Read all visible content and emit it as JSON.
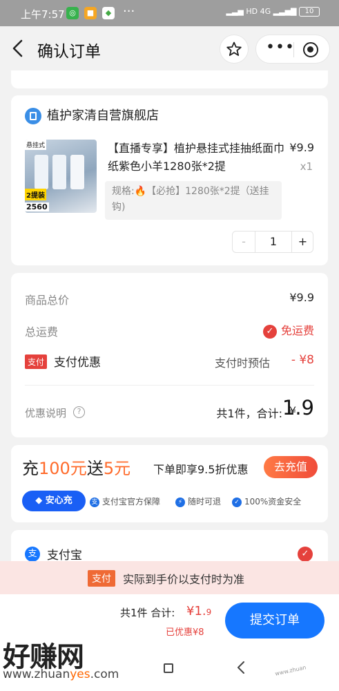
{
  "status_bar": {
    "time": "上午7:57",
    "hd": "HD",
    "network": "4G",
    "battery": "10"
  },
  "header": {
    "title": "确认订单"
  },
  "store": {
    "name": "植护家清自营旗舰店",
    "product": {
      "image_tag": "悬挂式",
      "image_badge": "2提装",
      "image_count": "2560",
      "title": "【直播专享】植护悬挂式挂抽纸面巾纸紫色小羊1280张*2提",
      "price": "¥9.9",
      "quantity_label": "x1",
      "spec": "规格:🔥【必抢】1280张*2提（送挂钩)",
      "stepper": {
        "minus": "-",
        "value": "1",
        "plus": "+"
      }
    }
  },
  "price_summary": {
    "goods_total_label": "商品总价",
    "goods_total_value": "¥9.9",
    "shipping_label": "总运费",
    "shipping_value": "免运费",
    "pay_badge": "支付",
    "pay_discount_label": "支付优惠",
    "pay_estimate_label": "支付时预估",
    "pay_discount_value": "- ¥8",
    "discount_info_label": "优惠说明",
    "total_label": "共1件，合计:",
    "total_currency": "¥",
    "total_amount": "1.9"
  },
  "recharge": {
    "title_prefix": "充",
    "title_amount": "100元",
    "title_mid": "送",
    "title_bonus": "5元",
    "subtitle": "下单即享9.5折优惠",
    "button": "去充值",
    "anxin_label": "安心充",
    "guarantees": [
      "支付宝官方保障",
      "随时可退",
      "100%资金安全"
    ]
  },
  "payment": {
    "method": "支付宝"
  },
  "notice": {
    "tag": "支付",
    "text": "实际到手价以支付时为准"
  },
  "bottom_bar": {
    "count_label": "共1件 合计:",
    "amount_main": "¥1.",
    "amount_decimal": "9",
    "saved": "已优惠¥8",
    "submit": "提交订单"
  },
  "watermark": {
    "logo": "好赚网",
    "url_a": "www.zhuan",
    "url_b": "yes",
    "url_c": ".com"
  },
  "colors": {
    "accent_blue": "#1677ff",
    "price_red": "#e5413c",
    "orange": "#ff6a2a"
  }
}
